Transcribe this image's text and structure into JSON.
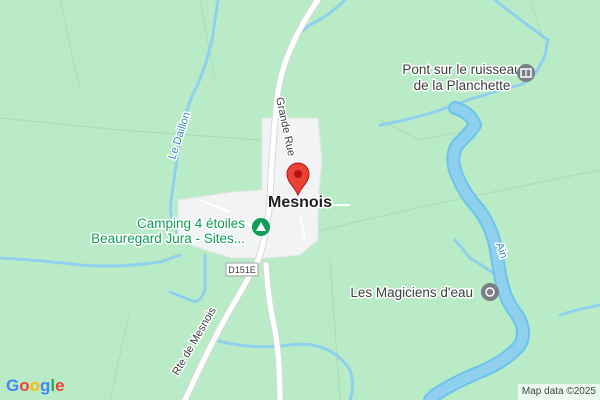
{
  "map": {
    "town_label": "Mesnois",
    "pois": [
      {
        "id": "bridge",
        "line1": "Pont sur le ruisseau",
        "line2": "de la Planchette",
        "icon": "monument-icon"
      },
      {
        "id": "camping",
        "line1": "Camping 4 étoiles",
        "line2": "Beauregard Jura - Sites...",
        "icon": "campground-icon"
      },
      {
        "id": "magiciens",
        "line1": "Les Magiciens d'eau",
        "line2": "",
        "icon": "attraction-icon"
      }
    ],
    "roads": {
      "grande_rue": "Grande Rue",
      "rte_mesnois": "Rte de Mesnois",
      "shield": "D151E"
    },
    "waterways": {
      "daillon": "Le Daillon",
      "ain": "Ain"
    },
    "pin": {
      "icon": "map-pin-icon",
      "color": "#ea4335"
    },
    "colors": {
      "land": "#b9ecc6",
      "water": "#8fd0ef",
      "river_outline": "#6cc3ec",
      "village": "#f1f3f4",
      "road": "#ffffff",
      "poi_gray": "#7a7f85",
      "camping_green": "#0f9d58"
    }
  },
  "logo": {
    "letters": [
      {
        "ch": "G",
        "color": "#4285f4"
      },
      {
        "ch": "o",
        "color": "#ea4335"
      },
      {
        "ch": "o",
        "color": "#fbbc05"
      },
      {
        "ch": "g",
        "color": "#4285f4"
      },
      {
        "ch": "l",
        "color": "#34a853"
      },
      {
        "ch": "e",
        "color": "#ea4335"
      }
    ]
  },
  "attribution": "Map data ©2025"
}
